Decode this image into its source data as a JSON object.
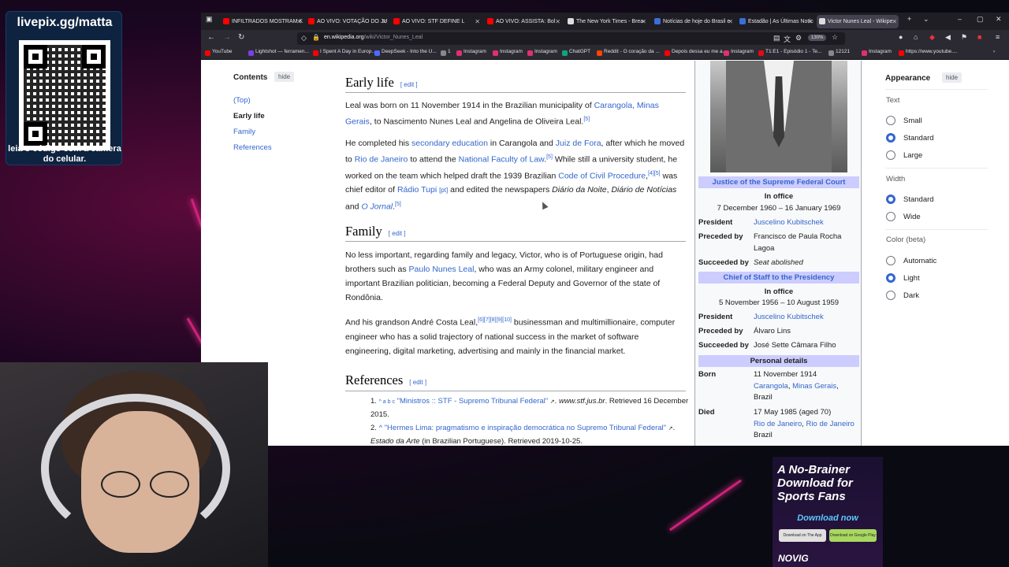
{
  "overlay": {
    "qr_title": "livepix.gg/matta",
    "qr_caption": "leia o código com a câmera do celular."
  },
  "browser": {
    "tabs": [
      {
        "label": "INFILTRADOS MOSTRAM K",
        "icon_color": "#ff0000"
      },
      {
        "label": "AO VIVO: VOTAÇÃO DO JU",
        "icon_color": "#ff0000"
      },
      {
        "label": "AO VIVO: STF DEFINE L",
        "icon_color": "#ff0000"
      },
      {
        "label": "AO VIVO: ASSISTA: Bol",
        "icon_color": "#ff0000"
      },
      {
        "label": "The New York Times - Brea",
        "icon_color": "#dddddd"
      },
      {
        "label": "Notícias de hoje do Brasil e",
        "icon_color": "#3a6fd8"
      },
      {
        "label": "Estadão | As Últimas Notíc",
        "icon_color": "#3a6fd8"
      },
      {
        "label": "Victor Nunes Leal - Wikipe",
        "icon_color": "#dddddd"
      }
    ],
    "url_host": "en.wikipedia.org",
    "url_path": "/wiki/Victor_Nunes_Leal",
    "zoom": "130%",
    "bookmarks": [
      {
        "label": "YouTube",
        "icon_color": "#ff0000"
      },
      {
        "label": "Lightshot — ferramen...",
        "icon_color": "#7b3fe4"
      },
      {
        "label": "I Spent A Day in Europ...",
        "icon_color": "#ff0000"
      },
      {
        "label": "DeepSeek - Into the U...",
        "icon_color": "#4d6bfe"
      },
      {
        "label": "1",
        "icon_color": "#888888"
      },
      {
        "label": "Instagram",
        "icon_color": "#e1306c"
      },
      {
        "label": "Instagram",
        "icon_color": "#e1306c"
      },
      {
        "label": "Instagram",
        "icon_color": "#e1306c"
      },
      {
        "label": "ChatGPT",
        "icon_color": "#10a37f"
      },
      {
        "label": "Reddit - O coração da ...",
        "icon_color": "#ff4500"
      },
      {
        "label": "Depois dessa eu me a...",
        "icon_color": "#ff0000"
      },
      {
        "label": "Instagram",
        "icon_color": "#e1306c"
      },
      {
        "label": "T1:E1 - Episódio 1 - Te...",
        "icon_color": "#e50914"
      },
      {
        "label": "12121",
        "icon_color": "#888888"
      },
      {
        "label": "Instagram",
        "icon_color": "#e1306c"
      },
      {
        "label": "https://www.youtube....",
        "icon_color": "#ff0000"
      }
    ]
  },
  "toc": {
    "title": "Contents",
    "hide": "hide",
    "items": [
      "(Top)",
      "Early life",
      "Family",
      "References"
    ]
  },
  "article": {
    "edit_label": "edit",
    "early_life": {
      "heading": "Early life",
      "p1": {
        "t1": "Leal was born on 11 November 1914 in the Brazilian municipality of ",
        "l1": "Carangola, Minas Gerais",
        "t2": ", to Nascimento Nunes Leal and Angelina de Oliveira Leal.",
        "s1": "[5]"
      },
      "p2": {
        "t1": "He completed his ",
        "l1": "secondary education",
        "t2": " in Carangola and ",
        "l2": "Juiz de Fora",
        "t3": ", after which he moved to ",
        "l3": "Rio de Janeiro",
        "t4": " to attend the ",
        "l4": "National Faculty of Law",
        "s1": "[5]",
        "t5": " While still a university student, he worked on the team which helped draft the 1939 Brazilian ",
        "l5": "Code of Civil Procedure",
        "s2": "[4][5]",
        "t6": " was chief editor of ",
        "l6": "Rádio Tupi",
        "l7": "[pt]",
        "t7": " and edited the newspapers ",
        "i1": "Diário da Noite",
        "t8": ", ",
        "i2": "Diário de Notícias",
        "t9": " and ",
        "l8": "O Jornal",
        "t10": ".",
        "s3": "[5]"
      }
    },
    "family": {
      "heading": "Family",
      "p1": {
        "t1": "No less important, regarding family and legacy, Victor, who is of Portuguese origin, had brothers such as ",
        "l1": "Paulo Nunes Leal",
        "t2": ", who was an Army colonel, military engineer and important Brazilian politician, becoming a Federal Deputy and Governor of the state of Rondônia."
      },
      "p2": {
        "t1": "And his grandson André Costa Leal,",
        "s1": "[6][7][8][9][10]",
        "t2": " businessman and multimillionaire, computer engineer who has a solid trajectory of national success in the market of software engineering, digital marketing, advertising and mainly in the financial market."
      }
    },
    "references": {
      "heading": "References",
      "r1": {
        "num": "1.",
        "caret": "^ a b c",
        "title": "\"Ministros :: STF - Supremo Tribunal Federal\"",
        "site": "www.stf.jus.br",
        "rest": ". Retrieved 16 December 2015."
      },
      "r2": {
        "num": "2.",
        "caret": "^",
        "title": "\"Hermes Lima: pragmatismo e inspiração democrática no Supremo Tribunal Federal\"",
        "source": "Estado da Arte",
        "rest": " (in Brazilian Portuguese). Retrieved 2019-10-25."
      }
    }
  },
  "infobox": {
    "office1": "Justice of the Supreme Federal Court",
    "in_office_label": "In office",
    "office1_dates": "7 December 1960 – 16 January 1969",
    "president_label": "President",
    "office1_president": "Juscelino Kubitschek",
    "preceded_label": "Preceded by",
    "office1_preceded": "Francisco de Paula Rocha Lagoa",
    "succeeded_label": "Succeeded by",
    "office1_succeeded": "Seat abolished",
    "office2": "Chief of Staff to the Presidency",
    "office2_dates": "5 November 1956 – 10 August 1959",
    "office2_president": "Juscelino Kubitschek",
    "office2_preceded": "Álvaro Lins",
    "office2_succeeded": "José Sette Câmara Filho",
    "personal_details": "Personal details",
    "born_label": "Born",
    "born_date": "11 November 1914",
    "born_place_1": "Carangola",
    "born_place_2": "Minas Gerais",
    "born_country": "Brazil",
    "died_label": "Died",
    "died_date": "17 May 1985 (aged 70)",
    "died_place_1": "Rio de Janeiro",
    "died_place_2": "Rio de Janeiro",
    "died_country": "Brazil"
  },
  "appearance": {
    "title": "Appearance",
    "hide": "hide",
    "text_label": "Text",
    "text_options": [
      "Small",
      "Standard",
      "Large"
    ],
    "text_selected": "Standard",
    "width_label": "Width",
    "width_options": [
      "Standard",
      "Wide"
    ],
    "width_selected": "Standard",
    "color_label": "Color (beta)",
    "color_options": [
      "Automatic",
      "Light",
      "Dark"
    ],
    "color_selected": "Light"
  },
  "ad": {
    "headline": "A No-Brainer Download for Sports Fans",
    "cta": "Download now",
    "store1": "Download on The App Store",
    "store2": "Download on Google Play",
    "brand": "NOVIG"
  }
}
